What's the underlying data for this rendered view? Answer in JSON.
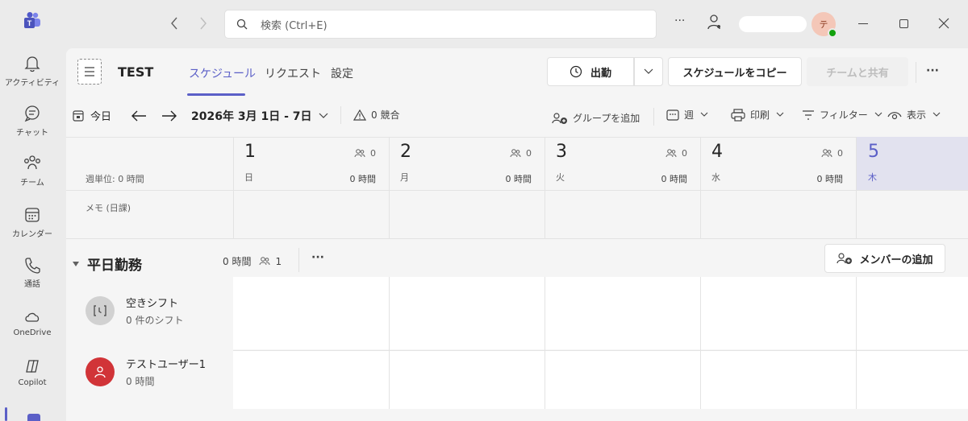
{
  "titlebar": {
    "search_placeholder": "検索 (Ctrl+E)",
    "avatar_initial": "テ",
    "more": "···"
  },
  "rail": [
    {
      "icon": "bell-icon",
      "label": "アクティビティ"
    },
    {
      "icon": "chat-icon",
      "label": "チャット"
    },
    {
      "icon": "teams-icon",
      "label": "チーム"
    },
    {
      "icon": "calendar-icon",
      "label": "カレンダー"
    },
    {
      "icon": "phone-icon",
      "label": "通話"
    },
    {
      "icon": "onedrive-icon",
      "label": "OneDrive"
    },
    {
      "icon": "copilot-icon",
      "label": "Copilot"
    }
  ],
  "header": {
    "team_name": "TEST",
    "tabs": [
      "スケジュール",
      "リクエスト",
      "設定"
    ],
    "clock_in": "出勤",
    "copy_schedule": "スケジュールをコピー",
    "share_team": "チームと共有",
    "more": "···"
  },
  "toolbar": {
    "today": "今日",
    "date_range": "2026年 3月 1日 - 7日",
    "conflicts": "0 競合",
    "add_group": "グループを追加",
    "view": "週",
    "print": "印刷",
    "filter": "フィルター",
    "display": "表示"
  },
  "grid": {
    "week_unit": "週単位: 0 時間",
    "memo": "メモ (日課)",
    "days": [
      {
        "num": "1",
        "name": "日",
        "count": "0",
        "hours": "0 時間"
      },
      {
        "num": "2",
        "name": "月",
        "count": "0",
        "hours": "0 時間"
      },
      {
        "num": "3",
        "name": "火",
        "count": "0",
        "hours": "0 時間"
      },
      {
        "num": "4",
        "name": "水",
        "count": "0",
        "hours": "0 時間"
      },
      {
        "num": "5",
        "name": "木",
        "count": "",
        "hours": ""
      }
    ]
  },
  "group": {
    "name": "平日勤務",
    "hours": "0 時間",
    "members_count": "1",
    "more": "···",
    "add_member": "メンバーの追加"
  },
  "rows": [
    {
      "name": "空きシフト",
      "sub": "0 件のシフト"
    },
    {
      "name": "テストユーザー1",
      "sub": "0 時間"
    }
  ]
}
